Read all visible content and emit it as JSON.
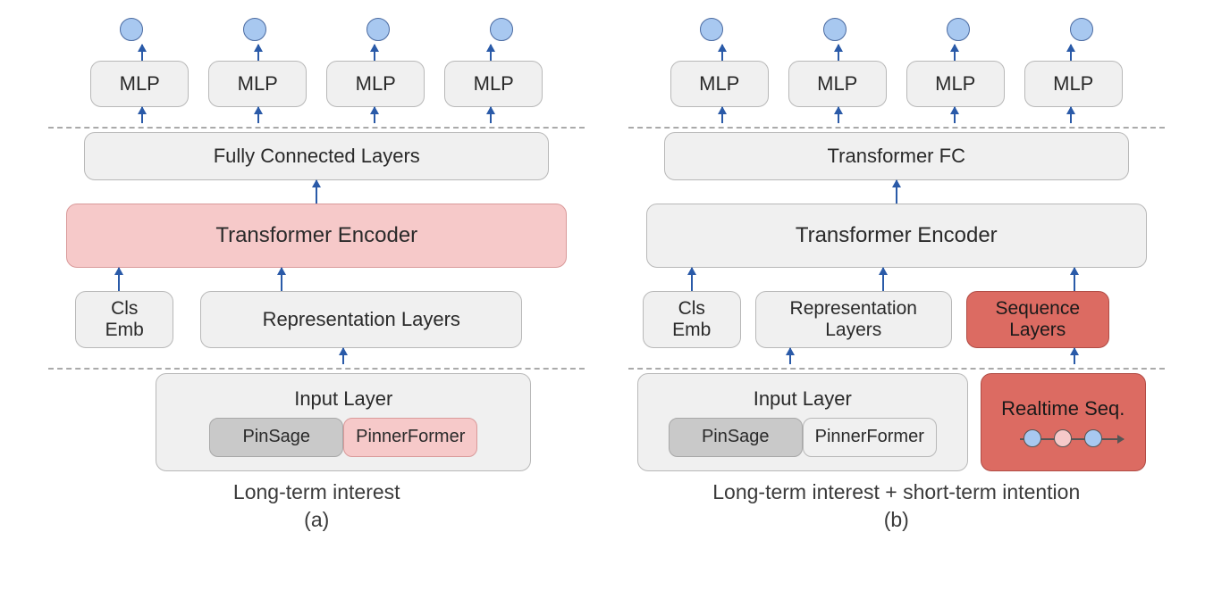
{
  "left": {
    "mlp": [
      "MLP",
      "MLP",
      "MLP",
      "MLP"
    ],
    "fc": "Fully Connected Layers",
    "encoder": "Transformer Encoder",
    "cls": "Cls\nEmb",
    "rep": "Representation Layers",
    "input_title": "Input Layer",
    "chip1": "PinSage",
    "chip2": "PinnerFormer",
    "caption_line1": "Long-term interest",
    "caption_line2": "(a)"
  },
  "right": {
    "mlp": [
      "MLP",
      "MLP",
      "MLP",
      "MLP"
    ],
    "fc": "Transformer FC",
    "encoder": "Transformer Encoder",
    "cls": "Cls\nEmb",
    "rep": "Representation\nLayers",
    "seq": "Sequence\nLayers",
    "input_title": "Input Layer",
    "chip1": "PinSage",
    "chip2": "PinnerFormer",
    "realtime": "Realtime Seq.",
    "caption_line1": "Long-term interest + short-term intention",
    "caption_line2": "(b)"
  }
}
